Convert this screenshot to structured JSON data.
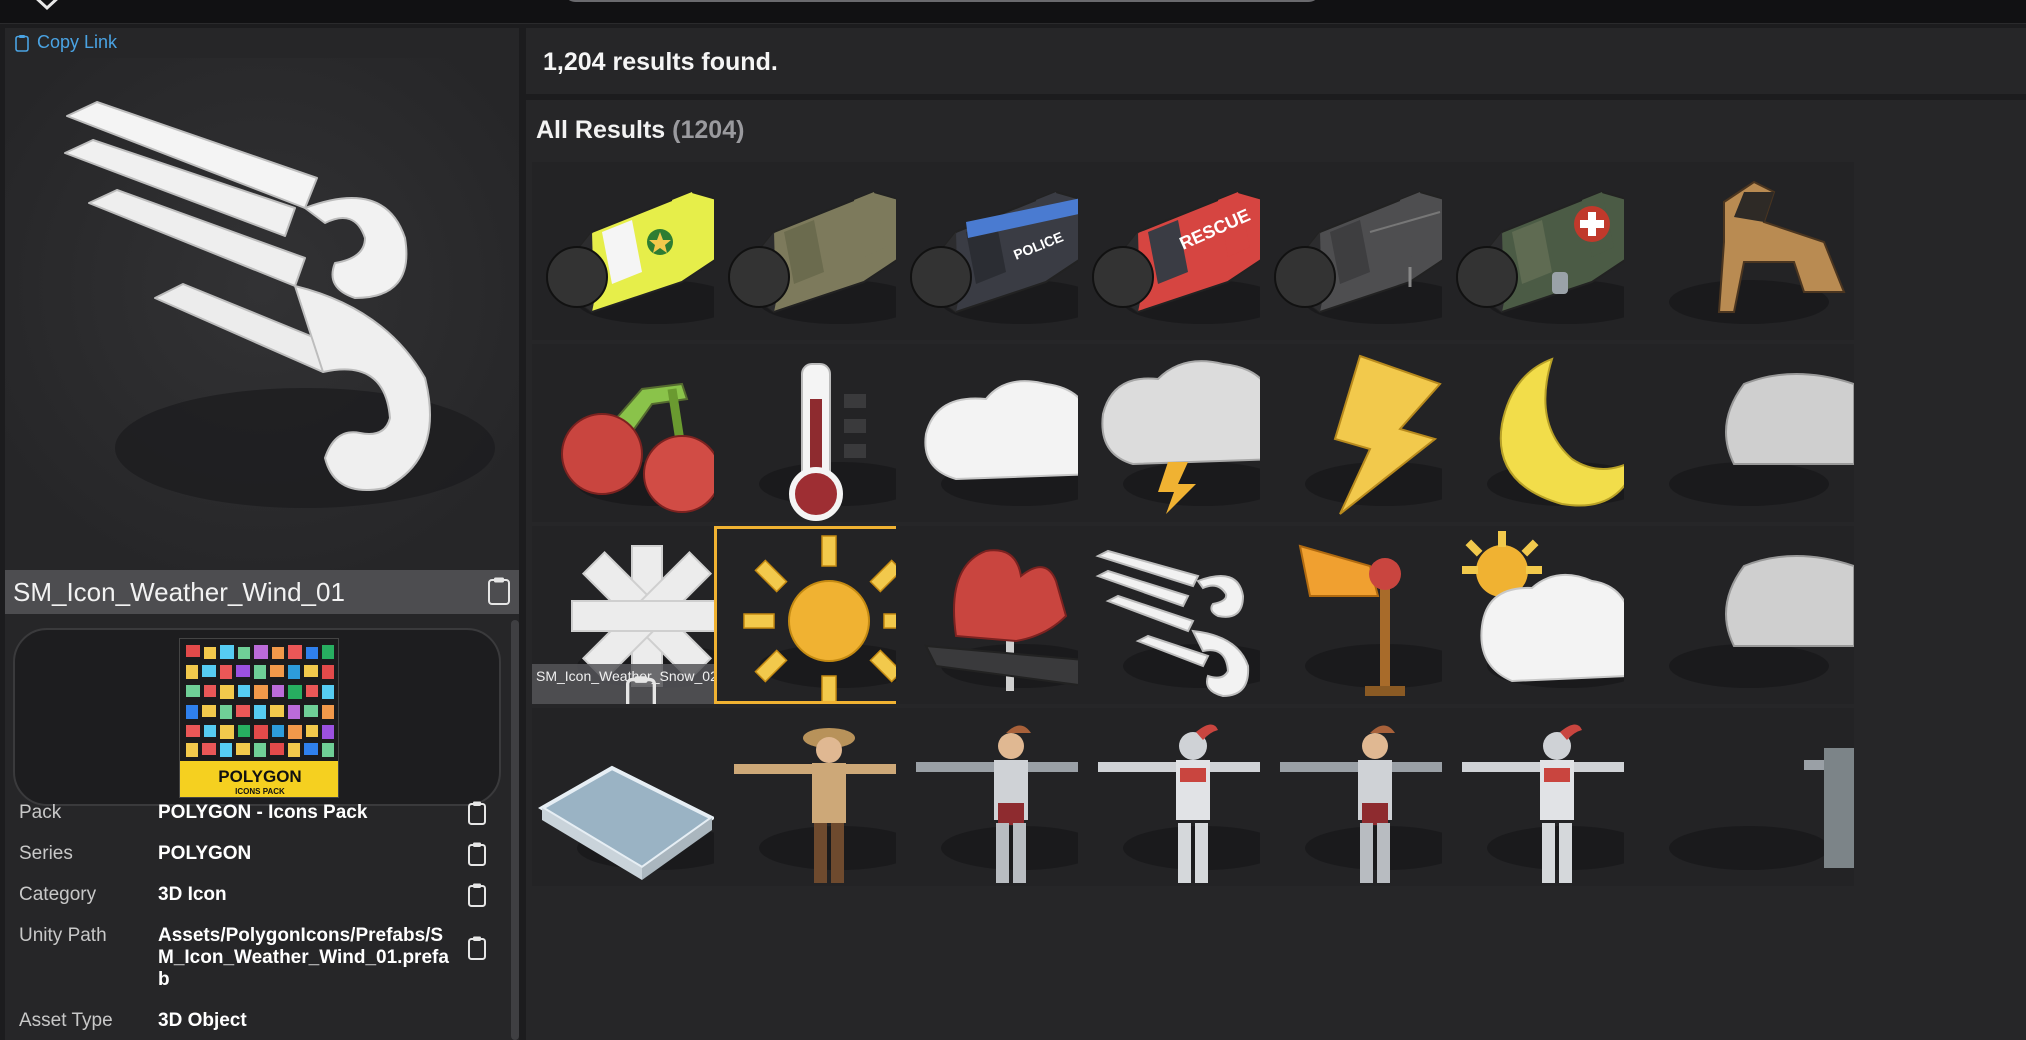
{
  "header": {
    "results_count": "1,204 results found."
  },
  "left_panel": {
    "copy_link": "Copy Link",
    "asset_name": "SM_Icon_Weather_Wind_01",
    "pack_thumb": {
      "title": "POLYGON",
      "subtitle": "ICONS PACK"
    },
    "details": [
      {
        "label": "Pack",
        "value": "POLYGON - Icons Pack"
      },
      {
        "label": "Series",
        "value": "POLYGON"
      },
      {
        "label": "Category",
        "value": "3D Icon"
      },
      {
        "label": "Unity Path",
        "value": "Assets/PolygonIcons/Prefabs/SM_Icon_Weather_Wind_01.prefab"
      },
      {
        "label": "Asset Type",
        "value": "3D Object"
      }
    ]
  },
  "results": {
    "section_title": "All Results",
    "section_count": "(1204)",
    "hover_label": "SM_Icon_Weather_Snow_02",
    "selected_index": 15,
    "items": [
      "dog-vest-yellow-icon",
      "dog-vest-camo-icon",
      "dog-vest-police-icon",
      "dog-vest-rescue-icon",
      "dog-vest-grey-icon",
      "dog-vest-medic-icon",
      "dog-icon",
      "cherries-icon",
      "thermometer-icon",
      "cloud-icon",
      "storm-cloud-icon",
      "lightning-icon",
      "crescent-moon-icon",
      "cloud-partial-icon",
      "snowflake-icon",
      "sun-icon",
      "weather-vane-icon",
      "wind-icon",
      "windsock-icon",
      "sun-cloud-icon",
      "cloud-partial-icon",
      "plane-tile-icon",
      "sheriff-character-icon",
      "knight-female-character-icon",
      "knight-male-character-icon",
      "knight-female-character-icon",
      "knight-male-character-icon",
      "character-partial-icon"
    ]
  },
  "colors": {
    "accent_link": "#4aa3e3",
    "selection": "#f0b232",
    "panel": "#262628"
  }
}
